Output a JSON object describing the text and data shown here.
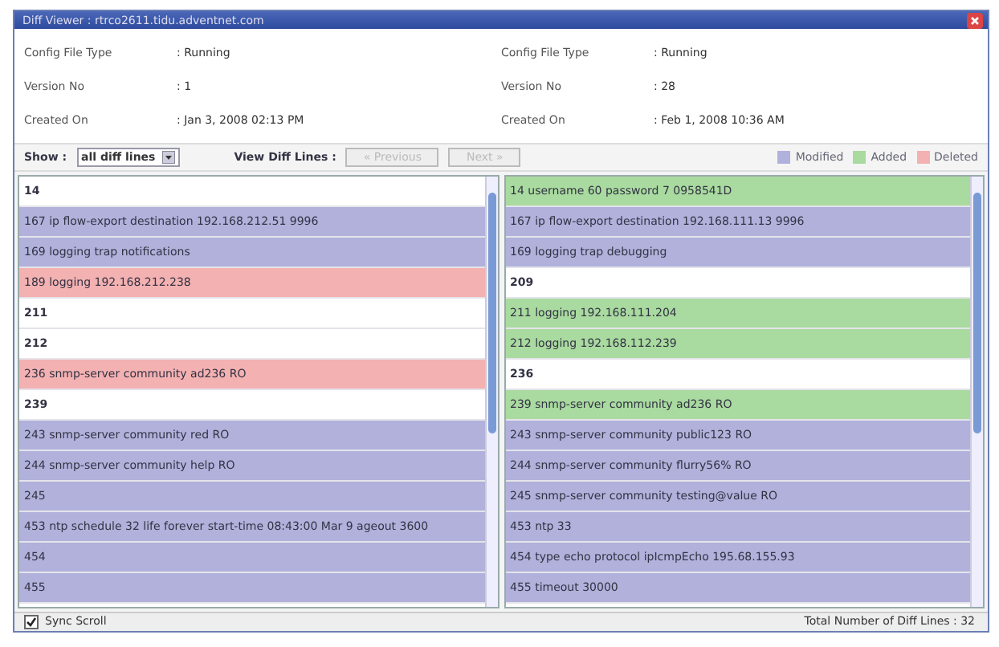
{
  "window": {
    "title": "Diff Viewer : rtrco2611.tidu.adventnet.com"
  },
  "info": [
    {
      "left": {
        "label": "Config File Type",
        "value": ": Running"
      },
      "right": {
        "label": "Config File Type",
        "value": ": Running"
      }
    },
    {
      "left": {
        "label": "Version No",
        "value": ": 1"
      },
      "right": {
        "label": "Version No",
        "value": ": 28"
      }
    },
    {
      "left": {
        "label": "Created On",
        "value": ": Jan 3, 2008 02:13 PM"
      },
      "right": {
        "label": "Created On",
        "value": ": Feb 1, 2008 10:36 AM"
      }
    }
  ],
  "toolbar": {
    "show_label": "Show :",
    "show_value": "all diff lines",
    "view_label": "View Diff Lines :",
    "buttons": [
      {
        "label": "« Previous",
        "disabled": true
      },
      {
        "label": "Next »",
        "disabled": true
      }
    ],
    "legend": [
      {
        "label": "Modified",
        "color": "#b1b1dc"
      },
      {
        "label": "Added",
        "color": "#a9da9f"
      },
      {
        "label": "Deleted",
        "color": "#f3b1b1"
      }
    ]
  },
  "panes": [
    {
      "rows": [
        {
          "text": "14",
          "kind": "same"
        },
        {
          "text": "167 ip flow-export destination 192.168.212.51 9996",
          "kind": "modified"
        },
        {
          "text": "169 logging trap notifications",
          "kind": "modified"
        },
        {
          "text": "189 logging 192.168.212.238",
          "kind": "deleted"
        },
        {
          "text": "211",
          "kind": "same"
        },
        {
          "text": "212",
          "kind": "same"
        },
        {
          "text": "236 snmp-server community ad236 RO",
          "kind": "deleted"
        },
        {
          "text": "239",
          "kind": "same"
        },
        {
          "text": "243 snmp-server community red RO",
          "kind": "modified"
        },
        {
          "text": "244 snmp-server community help RO",
          "kind": "modified"
        },
        {
          "text": "245",
          "kind": "modified"
        },
        {
          "text": "453 ntp schedule 32 life forever start-time 08:43:00 Mar 9 ageout 3600",
          "kind": "modified"
        },
        {
          "text": "454",
          "kind": "modified"
        },
        {
          "text": "455",
          "kind": "modified"
        }
      ]
    },
    {
      "rows": [
        {
          "text": "14   username 60 password 7 0958541D",
          "kind": "added"
        },
        {
          "text": "167 ip flow-export destination 192.168.111.13 9996",
          "kind": "modified"
        },
        {
          "text": "169 logging trap debugging",
          "kind": "modified"
        },
        {
          "text": "209",
          "kind": "same"
        },
        {
          "text": "211 logging 192.168.111.204",
          "kind": "added"
        },
        {
          "text": "212 logging 192.168.112.239",
          "kind": "added"
        },
        {
          "text": "236",
          "kind": "same"
        },
        {
          "text": "239 snmp-server community ad236 RO",
          "kind": "added"
        },
        {
          "text": "243 snmp-server community public123 RO",
          "kind": "modified"
        },
        {
          "text": "244 snmp-server community flurry56% RO",
          "kind": "modified"
        },
        {
          "text": "245 snmp-server community testing@value RO",
          "kind": "modified"
        },
        {
          "text": "453 ntp 33",
          "kind": "modified"
        },
        {
          "text": "454 type echo protocol ipIcmpEcho 195.68.155.93",
          "kind": "modified"
        },
        {
          "text": "455 timeout 30000",
          "kind": "modified"
        }
      ]
    }
  ],
  "status_bar": {
    "sync_scroll": {
      "label": "Sync Scroll",
      "checked": true
    },
    "total": "Total Number of Diff Lines : 32"
  }
}
